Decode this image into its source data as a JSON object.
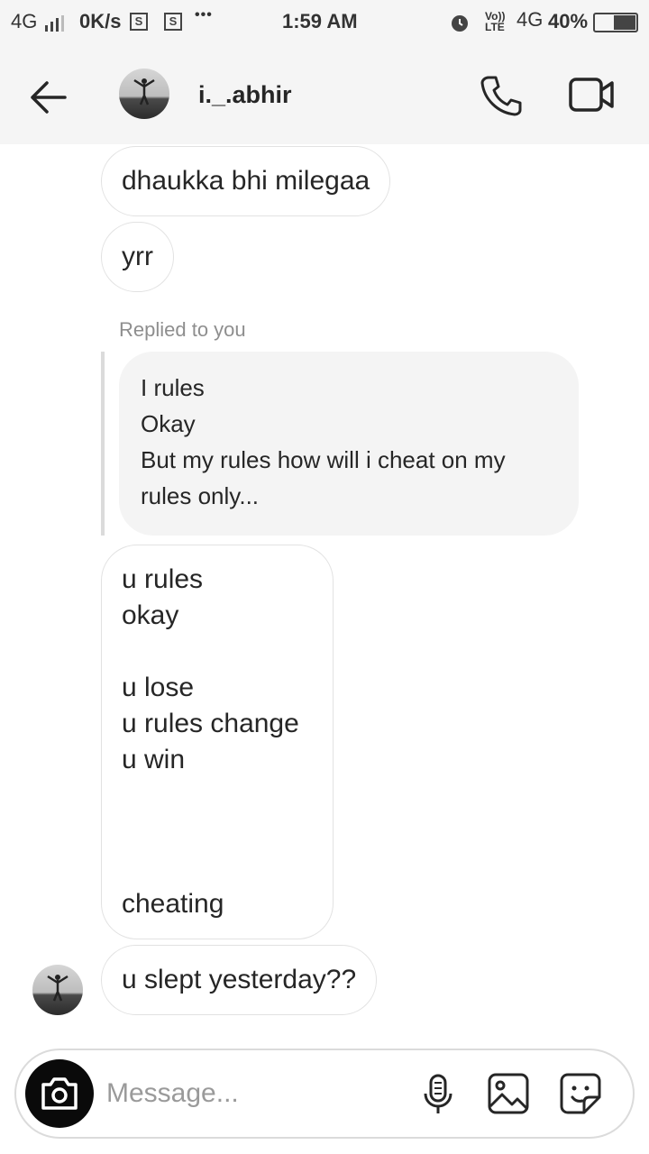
{
  "status_bar": {
    "network": "4G",
    "speed": "0K/s",
    "box1": "S",
    "box2": "S",
    "more": "•••",
    "time": "1:59 AM",
    "volte": "Vo)) LTE",
    "network_right": "4G",
    "battery": "40%"
  },
  "header": {
    "username": "i._.abhir",
    "icons": [
      "back-arrow-icon",
      "phone-icon",
      "video-camera-icon"
    ]
  },
  "messages": [
    {
      "text": "dhaukka bhi milegaa"
    },
    {
      "text": "yrr"
    },
    {
      "text": "u rules\nokay\n\nu lose\nu rules change\nu win\n\n\n\ncheating"
    },
    {
      "text": "u slept yesterday??"
    }
  ],
  "reply": {
    "label": "Replied to you",
    "quoted_text": "I rules\nOkay\nBut my rules how will i cheat on my rules only..."
  },
  "composer": {
    "placeholder": "Message...",
    "icons": [
      "camera-icon",
      "microphone-icon",
      "gallery-icon",
      "sticker-icon"
    ]
  }
}
